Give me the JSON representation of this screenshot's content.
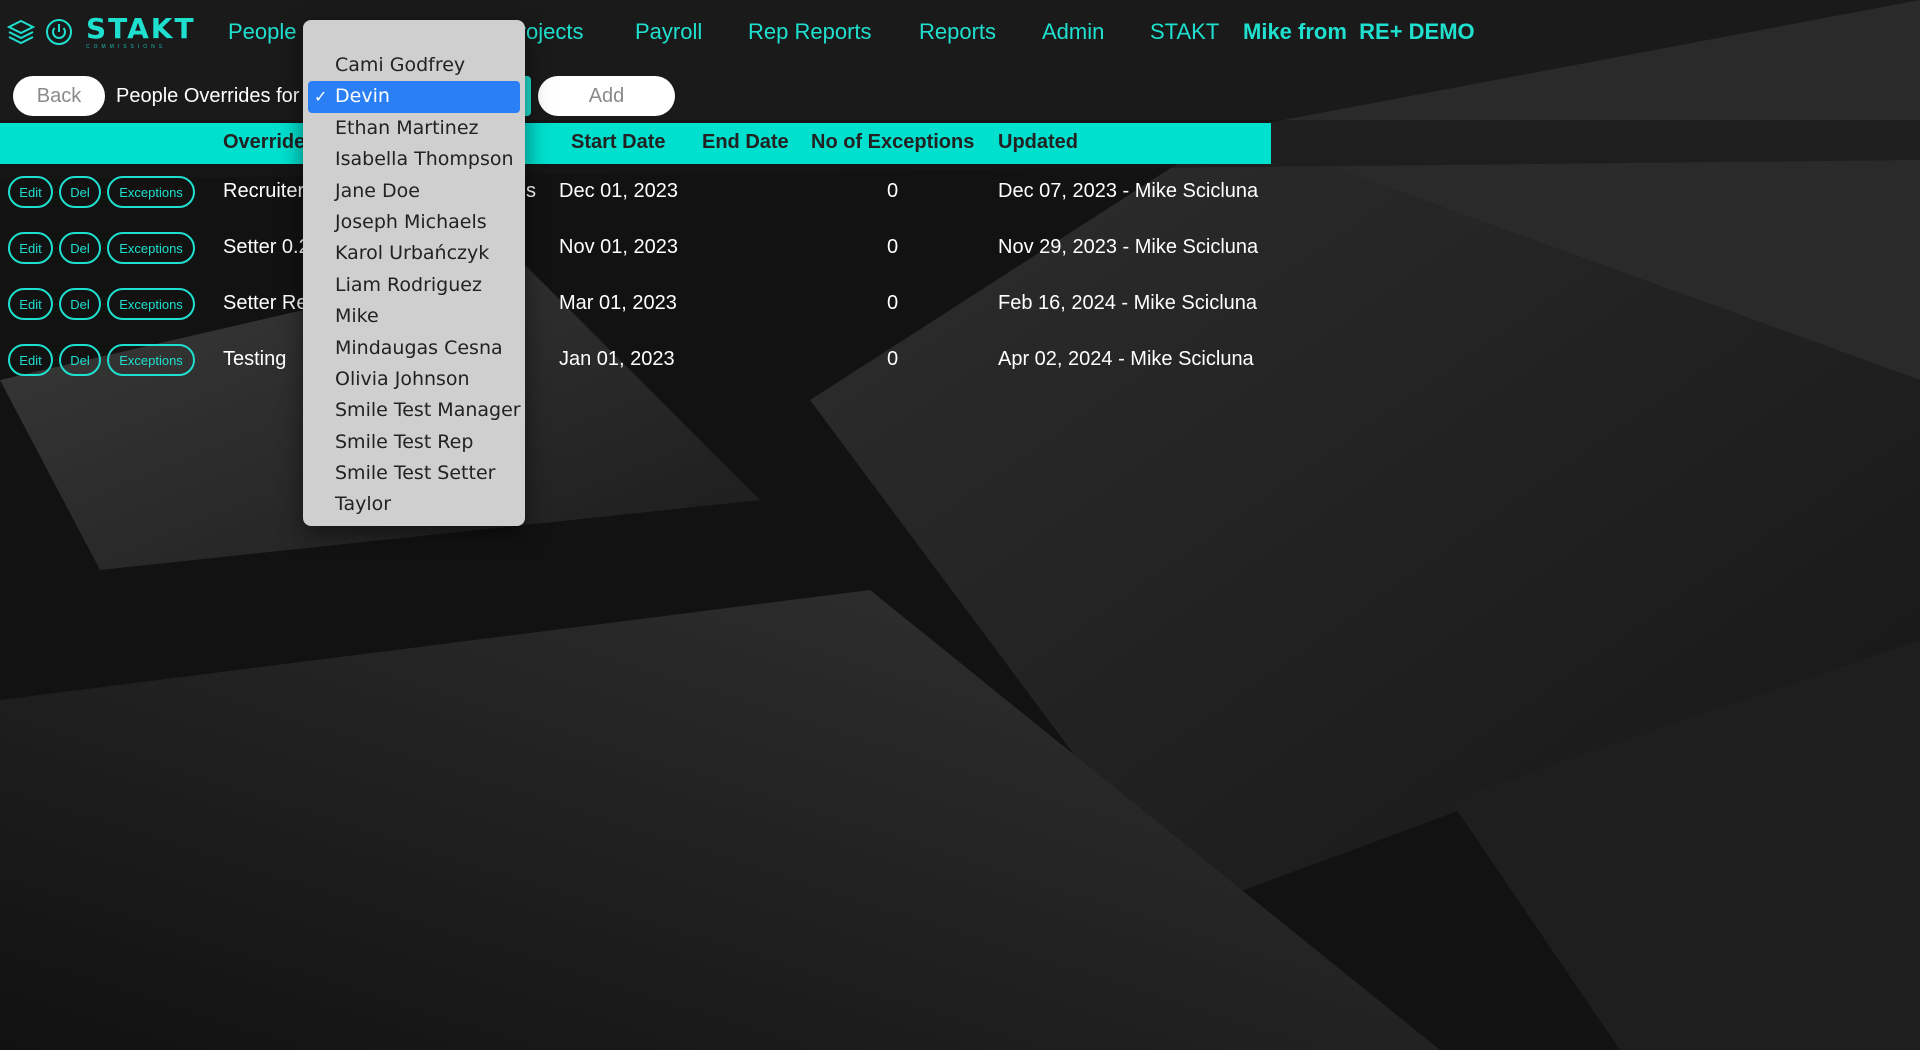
{
  "app": {
    "brand": "STAKT",
    "brand_sub": "COMMISSIONS"
  },
  "nav": {
    "items": [
      "People",
      "Projects",
      "Payroll",
      "Rep Reports",
      "Reports",
      "Admin",
      "STAKT"
    ],
    "user": "Mike from  RE+ DEMO"
  },
  "toolbar": {
    "back_label": "Back",
    "label": "People Overrides for",
    "selected_person": "Devin",
    "add_label": "Add"
  },
  "table": {
    "headers": [
      "Override",
      "Start Date",
      "End Date",
      "No of Exceptions",
      "Updated"
    ],
    "row_buttons": [
      "Edit",
      "Del",
      "Exceptions"
    ],
    "rows": [
      {
        "override": "Recruiter",
        "tail": "s",
        "start": "Dec 01, 2023",
        "end": "",
        "exceptions": "0",
        "updated": "Dec 07, 2023 - Mike Scicluna"
      },
      {
        "override": "Setter 0.2",
        "tail": "",
        "start": "Nov 01, 2023",
        "end": "",
        "exceptions": "0",
        "updated": "Nov 29, 2023 - Mike Scicluna"
      },
      {
        "override": "Setter Re",
        "tail": "",
        "start": "Mar 01, 2023",
        "end": "",
        "exceptions": "0",
        "updated": "Feb 16, 2024 - Mike Scicluna"
      },
      {
        "override": "Testing",
        "tail": "",
        "start": "Jan 01, 2023",
        "end": "",
        "exceptions": "0",
        "updated": "Apr 02, 2024 - Mike Scicluna"
      }
    ]
  },
  "dropdown": {
    "check_mark": "✓",
    "selected_index": 1,
    "options": [
      "Cami Godfrey",
      "Devin",
      "Ethan Martinez",
      "Isabella Thompson",
      "Jane Doe",
      "Joseph Michaels",
      "Karol Urbańczyk",
      "Liam Rodriguez",
      "Mike",
      "Mindaugas Cesna",
      "Olivia Johnson",
      "Smile Test Manager",
      "Smile Test Rep",
      "Smile Test Setter",
      "Taylor"
    ]
  },
  "colors": {
    "accent": "#1fe0cf",
    "header_bg": "#00e0cf",
    "selection": "#2a7ff5"
  }
}
